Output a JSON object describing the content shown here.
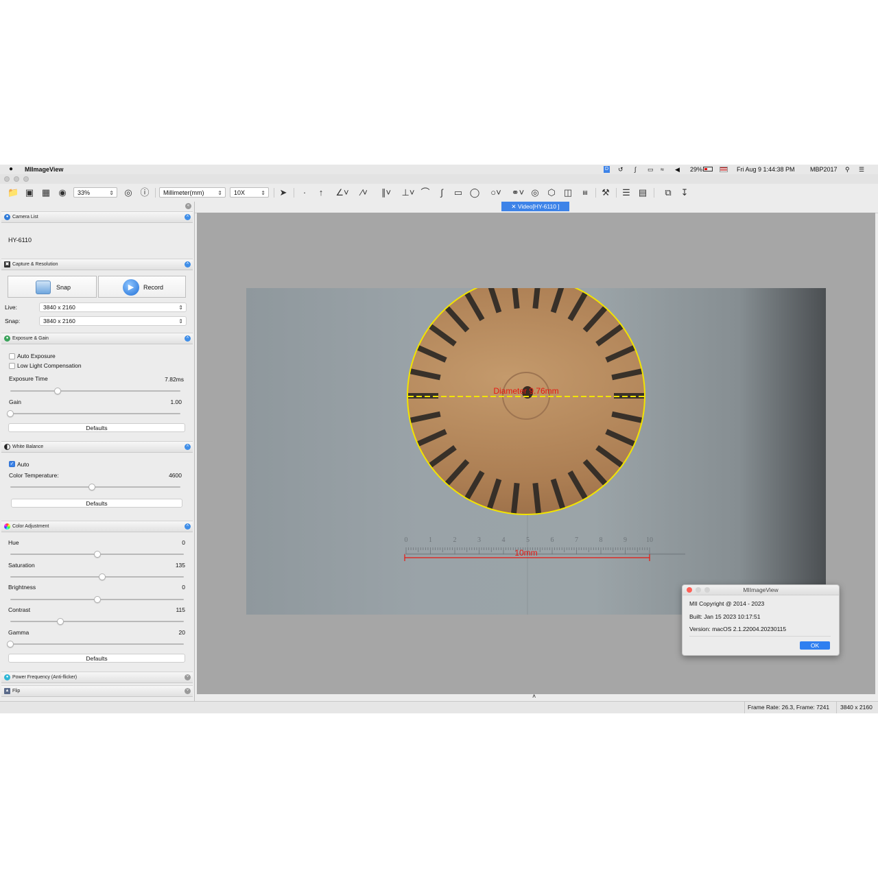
{
  "menubar": {
    "app_name": "MIImageView",
    "battery_percent": "29%",
    "datetime": "Fri Aug 9  1:44:38 PM",
    "user": "MBP2017"
  },
  "toolbar": {
    "zoom": "33%",
    "unit": "Millimeter(mm)",
    "magnification": "10X"
  },
  "sections": {
    "camera_list": "Camera List",
    "capture_resolution": "Capture & Resolution",
    "exposure_gain": "Exposure & Gain",
    "white_balance": "White Balance",
    "color_adjustment": "Color Adjustment",
    "power_frequency": "Power Frequency (Anti-flicker)",
    "flip": "Flip"
  },
  "camera": {
    "name": "HY-6110"
  },
  "capture": {
    "snap_label": "Snap",
    "record_label": "Record",
    "live_label": "Live:",
    "live_value": "3840 x 2160",
    "snap_res_label": "Snap:",
    "snap_res_value": "3840 x 2160"
  },
  "exposure": {
    "auto_exposure": "Auto Exposure",
    "low_light": "Low Light Compensation",
    "exposure_time_label": "Exposure Time",
    "exposure_time_value": "7.82ms",
    "exposure_position": 0.28,
    "gain_label": "Gain",
    "gain_value": "1.00",
    "gain_position": 0.0,
    "defaults": "Defaults"
  },
  "white_balance": {
    "auto_label": "Auto",
    "auto_checked": true,
    "color_temp_label": "Color Temperature:",
    "color_temp_value": "4600",
    "color_temp_position": 0.48,
    "defaults": "Defaults"
  },
  "color_adjustment": {
    "hue_label": "Hue",
    "hue_value": "0",
    "hue_position": 0.5,
    "saturation_label": "Saturation",
    "saturation_value": "135",
    "saturation_position": 0.53,
    "brightness_label": "Brightness",
    "brightness_value": "0",
    "brightness_position": 0.5,
    "contrast_label": "Contrast",
    "contrast_value": "115",
    "contrast_position": 0.29,
    "gamma_label": "Gamma",
    "gamma_value": "20",
    "gamma_position": 0.0,
    "defaults": "Defaults"
  },
  "view": {
    "tab_label": "Video[HY-6110 ]",
    "diameter_label": "Diameter 9.76mm",
    "scale_label": "10mm",
    "ruler_ticks": [
      "0",
      "1",
      "2",
      "3",
      "4",
      "5",
      "6",
      "7",
      "8",
      "9",
      "10"
    ]
  },
  "dialog": {
    "title": "MIImageView",
    "copyright": "MII Copyright @ 2014 - 2023",
    "built": "Built: Jan 15 2023 10:17:51",
    "version": "Version: macOS 2.1.22004.20230115",
    "ok": "OK"
  },
  "status": {
    "frame_info": "Frame Rate: 26.3, Frame: 7241",
    "resolution": "3840 x 2160"
  },
  "colors": {
    "accent": "#3d83e8",
    "measure_circle": "#f2e400",
    "measure_text": "#e8170f"
  }
}
